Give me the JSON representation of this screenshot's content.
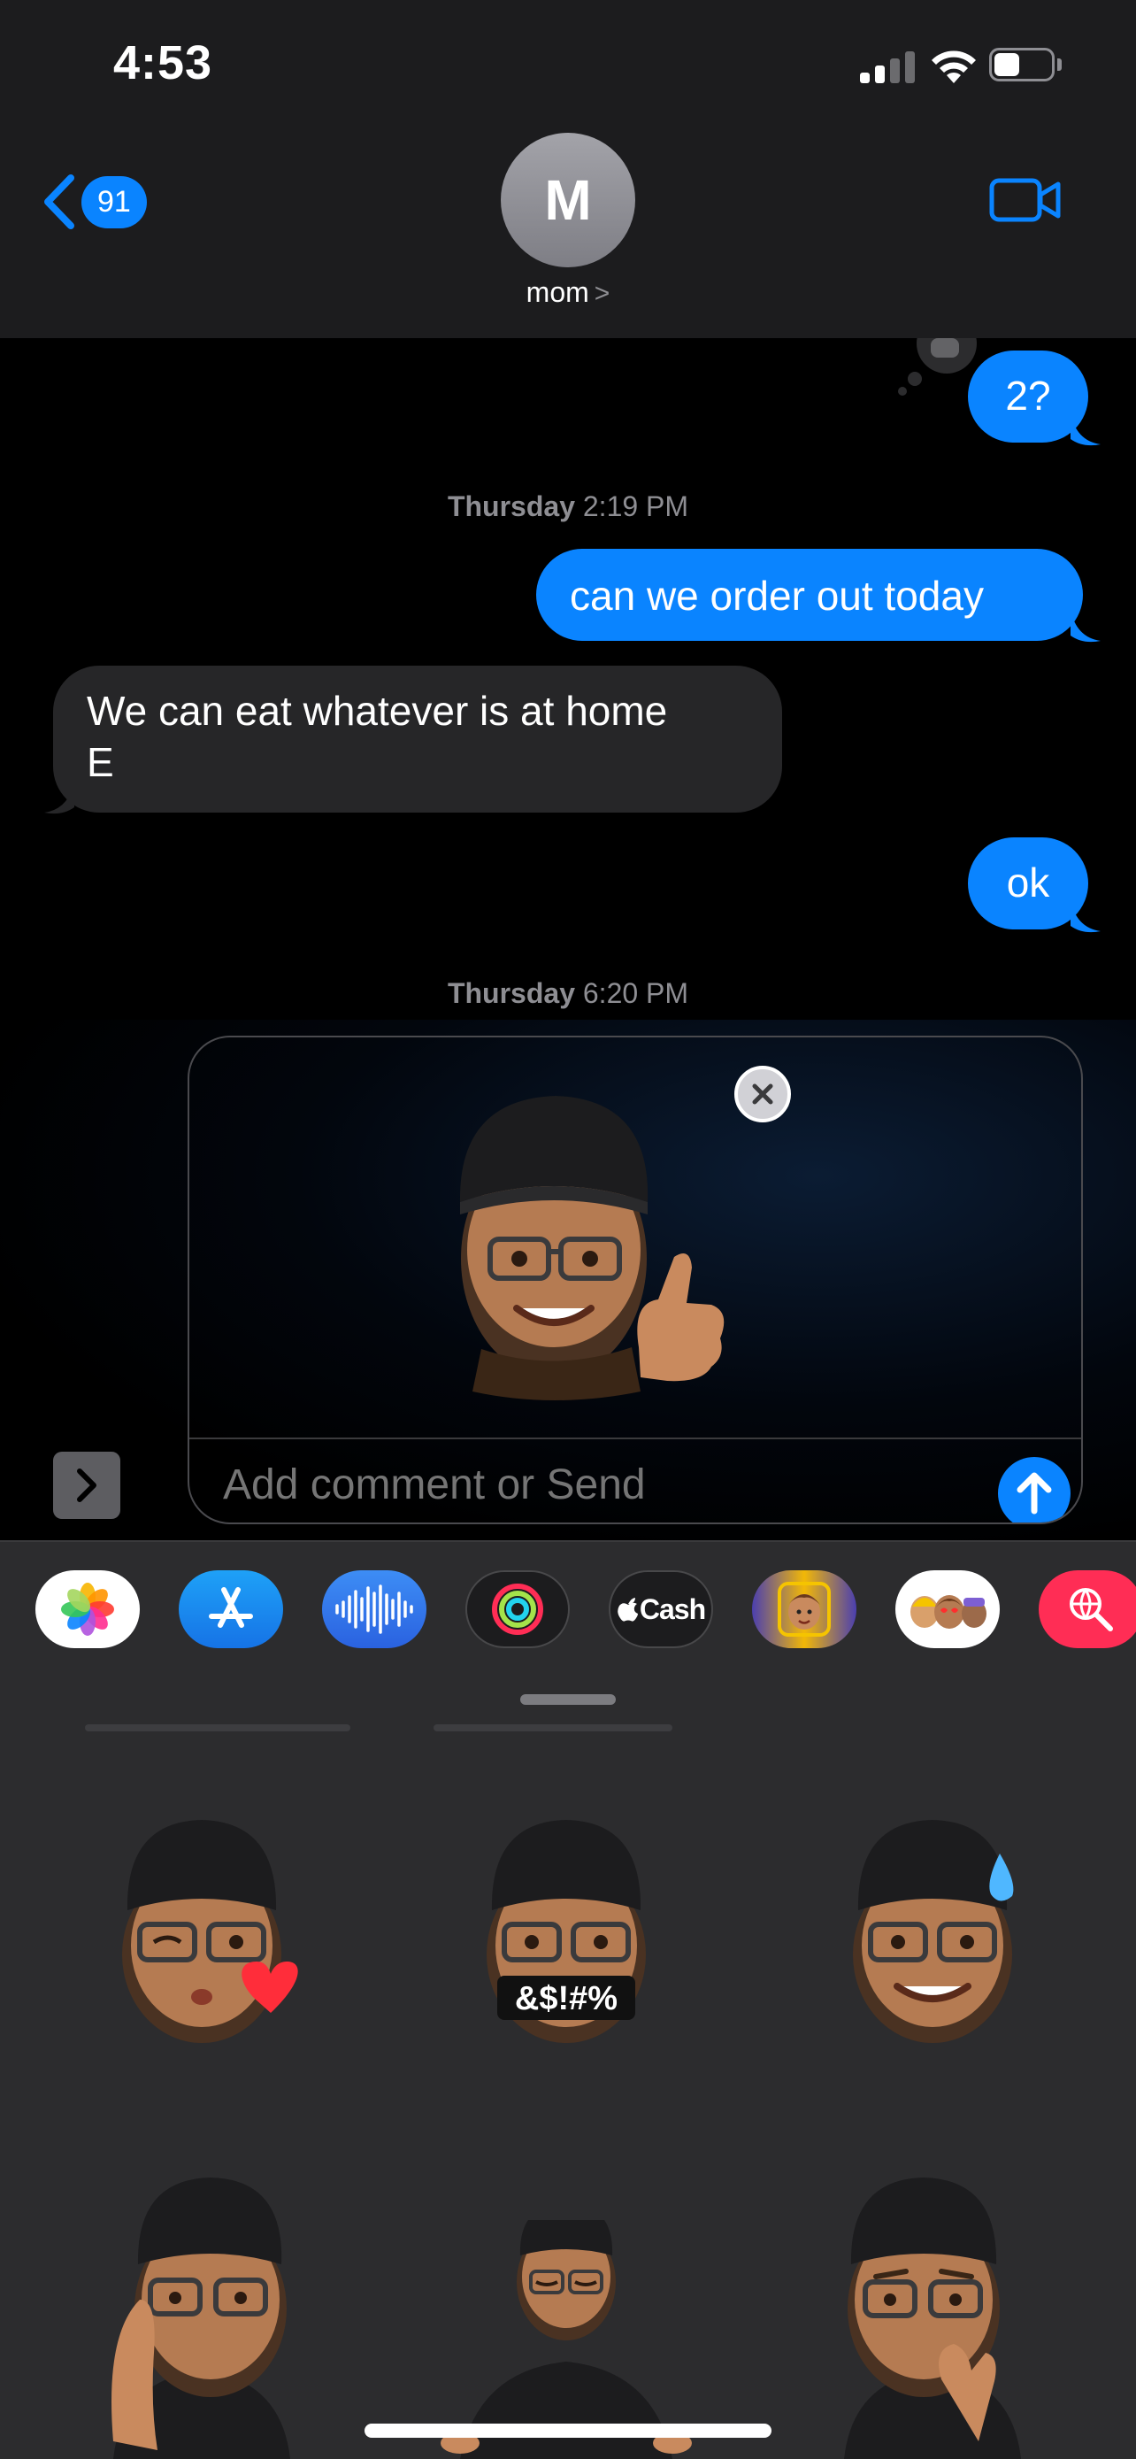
{
  "status_bar": {
    "time": "4:53",
    "signal_icon": "cellular-signal-icon",
    "wifi_icon": "wifi-icon",
    "battery_icon": "battery-icon",
    "battery_level": 0.45
  },
  "header": {
    "back_icon": "chevron-left-icon",
    "unread_count": "91",
    "avatar_initial": "M",
    "contact_name": "mom",
    "contact_chevron": ">",
    "facetime_icon": "video-camera-icon"
  },
  "messages": [
    {
      "side": "sent",
      "text": "2?"
    },
    {
      "type": "timestamp",
      "day": "Thursday",
      "time": "2:19 PM"
    },
    {
      "side": "sent",
      "text": "can we order out today"
    },
    {
      "side": "received",
      "line1": "We can eat whatever is at home",
      "line2": "E"
    },
    {
      "side": "sent",
      "text": "ok"
    },
    {
      "type": "timestamp",
      "day": "Thursday",
      "time": "6:20 PM"
    }
  ],
  "compose": {
    "expand_icon": "chevron-right-icon",
    "attachment": "memoji-thumbs-up-sticker",
    "remove_icon": "close-icon",
    "placeholder": "Add comment or Send",
    "send_icon": "arrow-up-icon"
  },
  "app_drawer": [
    {
      "name": "photos",
      "icon": "photos-icon"
    },
    {
      "name": "app-store",
      "icon": "app-store-icon"
    },
    {
      "name": "audio",
      "icon": "waveform-icon"
    },
    {
      "name": "fitness",
      "icon": "activity-rings-icon"
    },
    {
      "name": "apple-cash",
      "icon": "apple-logo-icon",
      "label": "Cash"
    },
    {
      "name": "memoji",
      "icon": "memoji-face-icon"
    },
    {
      "name": "memoji-stickers",
      "icon": "memoji-stickers-icon"
    },
    {
      "name": "image-search",
      "icon": "globe-search-icon"
    }
  ],
  "stickers": [
    {
      "name": "kiss-heart",
      "caption": ""
    },
    {
      "name": "swearing",
      "caption": "&$!#%"
    },
    {
      "name": "sweat-smile",
      "caption": ""
    },
    {
      "name": "shushing",
      "caption": ""
    },
    {
      "name": "meditating",
      "caption": ""
    },
    {
      "name": "nervous",
      "caption": ""
    }
  ],
  "colors": {
    "accent": "#0a84ff",
    "received_bubble": "#262628",
    "header_bg": "#1c1c1e",
    "panel_bg": "#2c2c2e"
  }
}
